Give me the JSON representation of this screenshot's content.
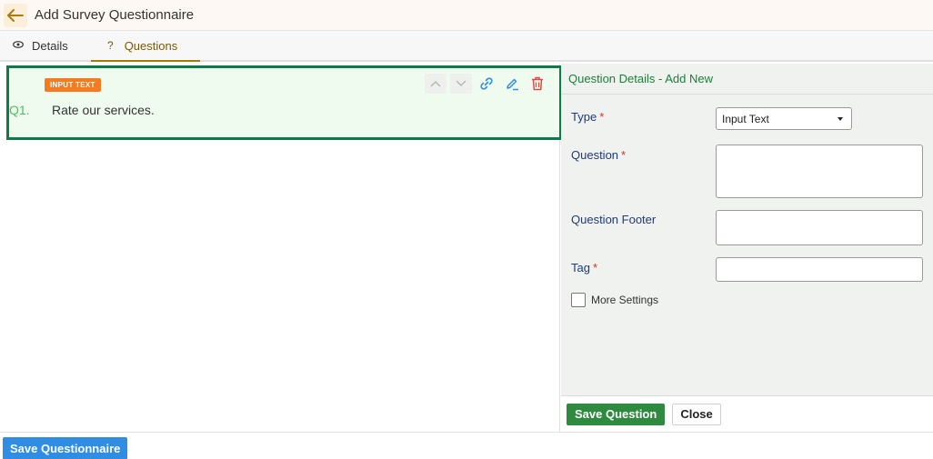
{
  "header": {
    "title": "Add Survey Questionnaire",
    "back_icon": "arrow-left-icon"
  },
  "tabs": [
    {
      "label": "Details",
      "icon": "eye-icon",
      "glyph": "👁"
    },
    {
      "label": "Questions",
      "icon": "question-mark-icon",
      "glyph": "?"
    }
  ],
  "question": {
    "badge": "INPUT TEXT",
    "number": "Q1.",
    "text": "Rate our services."
  },
  "details_panel": {
    "title": "Question Details - Add New",
    "type_label": "Type",
    "type_value": "Input Text",
    "question_label": "Question",
    "footer_label": "Question Footer",
    "tag_label": "Tag",
    "more_settings_label": "More Settings",
    "required_mark": "*"
  },
  "buttons": {
    "save_question": "Save Question",
    "close": "Close",
    "save_questionnaire": "Save Questionnaire"
  },
  "colors": {
    "accent_green": "#0d7a4a",
    "badge_orange": "#f47b20",
    "primary_blue": "#2f8de4",
    "save_green": "#2d8a3e"
  }
}
